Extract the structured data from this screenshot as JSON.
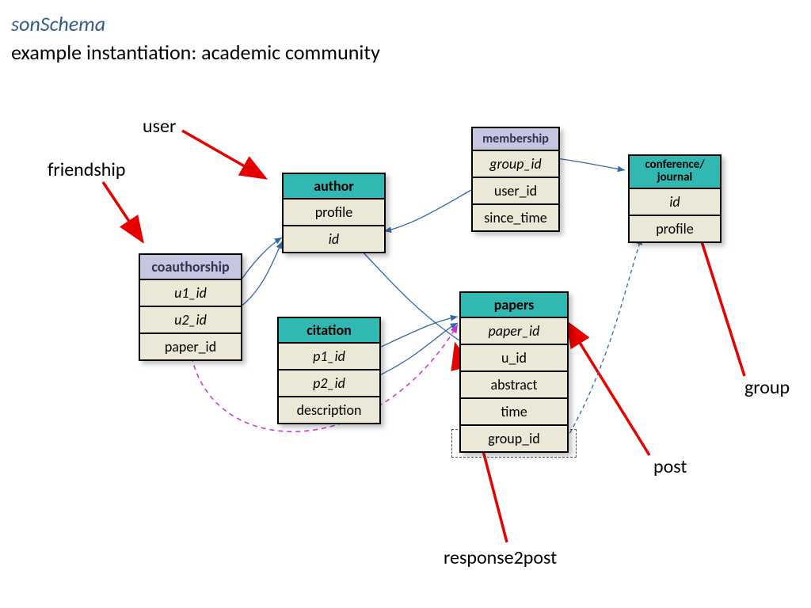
{
  "header": {
    "title": "sonSchema",
    "subtitle": "example instantiation:  academic community"
  },
  "annotations": {
    "user": "user",
    "friendship": "friendship",
    "group": "group",
    "post": "post",
    "response2post": "response2post"
  },
  "tables": {
    "coauthorship": {
      "header": "coauthorship",
      "rows": [
        "u1_id",
        "u2_id",
        "paper_id"
      ]
    },
    "author": {
      "header": "author",
      "rows": [
        "profile",
        "id"
      ]
    },
    "membership": {
      "header": "membership",
      "rows": [
        "group_id",
        "user_id",
        "since_time"
      ]
    },
    "conference": {
      "header": "conference/ journal",
      "rows": [
        "id",
        "profile"
      ]
    },
    "citation": {
      "header": "citation",
      "rows": [
        "p1_id",
        "p2_id",
        "description"
      ]
    },
    "papers": {
      "header": "papers",
      "rows": [
        "paper_id",
        "u_id",
        "abstract",
        "time",
        "group_id"
      ]
    }
  },
  "colors": {
    "teal": "#31b8b2",
    "lavender": "#c7c6e0",
    "beige": "#ece8d8",
    "red": "#e60000",
    "magenta": "#cc33cc",
    "blue": "#3366aa"
  }
}
